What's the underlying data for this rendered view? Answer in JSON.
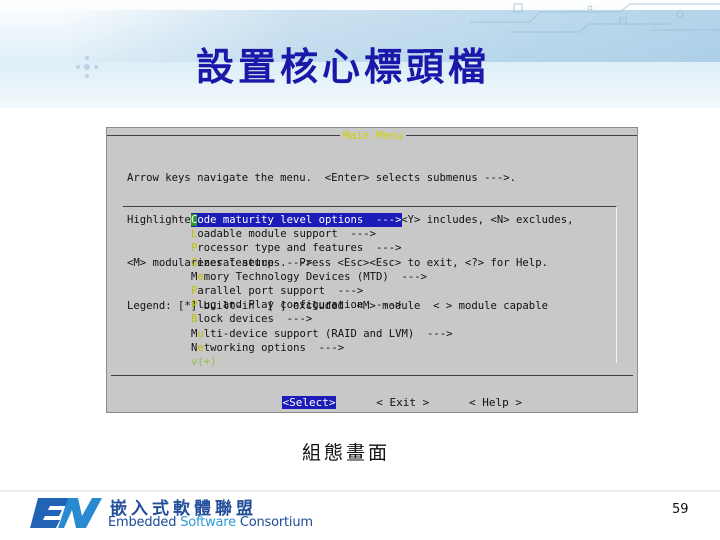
{
  "slide": {
    "title": "設置核心標頭檔",
    "caption": "組態畫面",
    "page_number": "59"
  },
  "terminal": {
    "window_title": "Main Menu",
    "help_lines": [
      "Arrow keys navigate the menu.  <Enter> selects submenus --->.",
      "Highlighted letters are hotkeys.  Pressing <Y> includes, <N> excludes,",
      "<M> modularizes features.  Press <Esc><Esc> to exit, <?> for Help.",
      "Legend: [*] built-in  [ ] excluded  <M> module  < > module capable"
    ],
    "menu_items": [
      {
        "hot": "C",
        "rest": "ode maturity level options  --->",
        "selected": true,
        "pre": ""
      },
      {
        "hot": "L",
        "rest": "oadable module support  --->",
        "selected": false,
        "pre": ""
      },
      {
        "hot": "P",
        "rest": "rocessor type and features  --->",
        "selected": false,
        "pre": ""
      },
      {
        "hot": "G",
        "rest": "eneral setup  --->",
        "selected": false,
        "pre": ""
      },
      {
        "hot": "e",
        "rest": "mory Technology Devices (MTD)  --->",
        "selected": false,
        "pre": "M"
      },
      {
        "hot": "P",
        "rest": "arallel port support  --->",
        "selected": false,
        "pre": ""
      },
      {
        "hot": "P",
        "rest": "lug and Play configuration  --->",
        "selected": false,
        "pre": ""
      },
      {
        "hot": "B",
        "rest": "lock devices  --->",
        "selected": false,
        "pre": ""
      },
      {
        "hot": "u",
        "rest": "lti-device support (RAID and LVM)  --->",
        "selected": false,
        "pre": "M"
      },
      {
        "hot": "e",
        "rest": "tworking options  --->",
        "selected": false,
        "pre": "N"
      }
    ],
    "more_indicator": "v(+)",
    "buttons": {
      "select": "<Select>",
      "exit": "< Exit >",
      "help": "< Help >"
    }
  },
  "footer": {
    "org_name_cn": "嵌入式軟體聯盟",
    "org_name_en_1": "Embedded ",
    "org_name_en_2": "Software",
    "org_name_en_3": " Consortium",
    "logo_text": "ESW"
  },
  "colors": {
    "title": "#1a18a8",
    "terminal_bg": "#c8c8c8",
    "selection": "#1c1cb8",
    "hotkey": "#c0c000"
  }
}
